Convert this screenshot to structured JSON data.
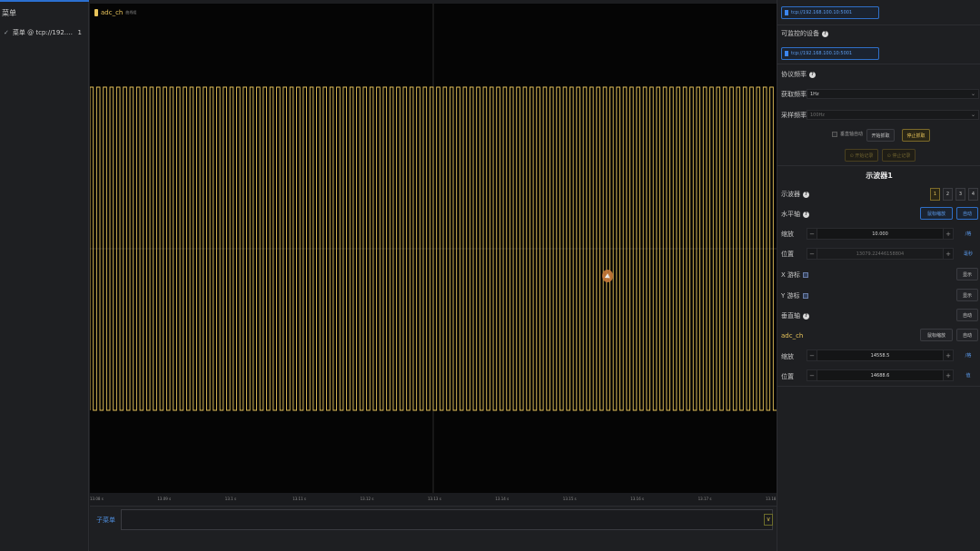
{
  "sidebar": {
    "title": "菜单",
    "items": [
      {
        "check": "✓",
        "label": "菜单 @ tcp://192.16...",
        "count": "1"
      }
    ]
  },
  "plot": {
    "legend": {
      "name": "adc_ch",
      "tag": "曲线组"
    },
    "color": "#e8c45a",
    "cycles": 103,
    "x_ticks": [
      "13.08 s",
      "13.09 s",
      "13.1 s",
      "13.11 s",
      "13.12 s",
      "13.13 s",
      "13.14 s",
      "13.15 s",
      "13.16 s",
      "13.17 s",
      "13.18 s"
    ]
  },
  "subbar": {
    "label": "子菜单",
    "button": "∨"
  },
  "panel": {
    "top_address": "tcp://192.168.100.10:5001",
    "controllable_label": "可监控的设备",
    "controllable_address": "tcp://192.168.100.10:5001",
    "sync_rate_label": "协议频率",
    "fetch_rate_label": "获取频率",
    "fetch_rate_value": "1Hz",
    "sample_rate_label": "采样频率",
    "sample_rate_value": "100Hz",
    "auto_fit_label": "垂直轴自动",
    "start_fetch": "开始抓取",
    "stop_fetch": "停止抓取",
    "start_record": "⊙ 开始记录",
    "stop_record": "⊙ 停止记录",
    "scope_title": "示波器1",
    "scope_label": "示波器",
    "scope_tabs": [
      "1",
      "2",
      "3",
      "4"
    ],
    "horizontal_label": "水平轴",
    "mouse_zoom": "鼠标缩放",
    "auto": "自动",
    "scale_label": "缩放",
    "h_scale_value": "10.000",
    "h_scale_unit": "/格",
    "position_label": "位置",
    "h_position_value": "13079.22446158804",
    "h_position_unit": "毫秒",
    "x_cursor_label": "X 游标",
    "y_cursor_label": "Y 游标",
    "show_btn": "显示",
    "vertical_label": "垂直轴",
    "vertical_auto": "自动",
    "channel_name": "adc_ch",
    "ch_mouse_zoom": "鼠标缩放",
    "ch_auto": "自动",
    "v_scale_value": "14558.5",
    "v_scale_unit": "/格",
    "v_position_value": "14688.6",
    "v_position_unit": "值"
  }
}
